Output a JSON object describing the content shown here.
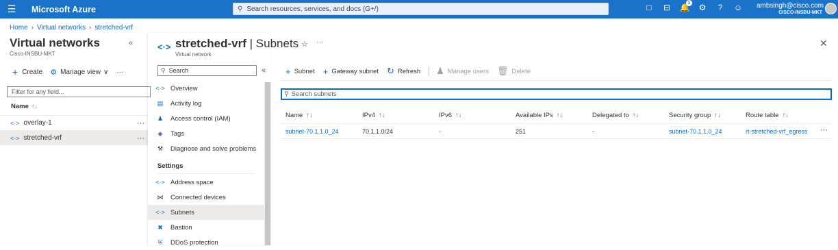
{
  "topbar": {
    "brand": "Microsoft Azure",
    "search_placeholder": "Search resources, services, and docs (G+/)",
    "notification_count": "1",
    "user_email": "ambsingh@cisco.com",
    "user_org": "CISCO-INSBU-MKT"
  },
  "breadcrumb": [
    "Home",
    "Virtual networks",
    "stretched-vrf"
  ],
  "left_pane": {
    "title": "Virtual networks",
    "subtitle": "Cisco-INSBU-MKT",
    "create_label": "Create",
    "manage_view_label": "Manage view",
    "filter_placeholder": "Filter for any field...",
    "column_name": "Name",
    "items": [
      "overlay-1",
      "stretched-vrf"
    ],
    "selected_item": "stretched-vrf"
  },
  "resource": {
    "name": "stretched-vrf",
    "section": "Subnets",
    "type": "Virtual network",
    "menu_search_placeholder": "Search",
    "nav_items": [
      "Overview",
      "Activity log",
      "Access control (IAM)",
      "Tags",
      "Diagnose and solve problems"
    ],
    "settings_heading": "Settings",
    "settings_items": [
      "Address space",
      "Connected devices",
      "Subnets",
      "Bastion",
      "DDoS protection"
    ],
    "selected_nav": "Subnets"
  },
  "toolbar": {
    "subnet": "Subnet",
    "gateway_subnet": "Gateway subnet",
    "refresh": "Refresh",
    "manage_users": "Manage users",
    "delete": "Delete"
  },
  "subnet_search_placeholder": "Search subnets",
  "table": {
    "columns": [
      "Name",
      "IPv4",
      "IPv6",
      "Available IPs",
      "Delegated to",
      "Security group",
      "Route table"
    ],
    "rows": [
      {
        "name": "subnet-70.1.1.0_24",
        "ipv4": "70.1.1.0/24",
        "ipv6": "-",
        "available_ips": "251",
        "delegated_to": "-",
        "security_group": "subnet-70.1.1.0_24",
        "route_table": "rt-stretched-vrf_egress"
      }
    ]
  },
  "colors": {
    "topbar": "#1a73c8",
    "link": "#0f6cbd",
    "selected_bg": "#edebe9"
  }
}
